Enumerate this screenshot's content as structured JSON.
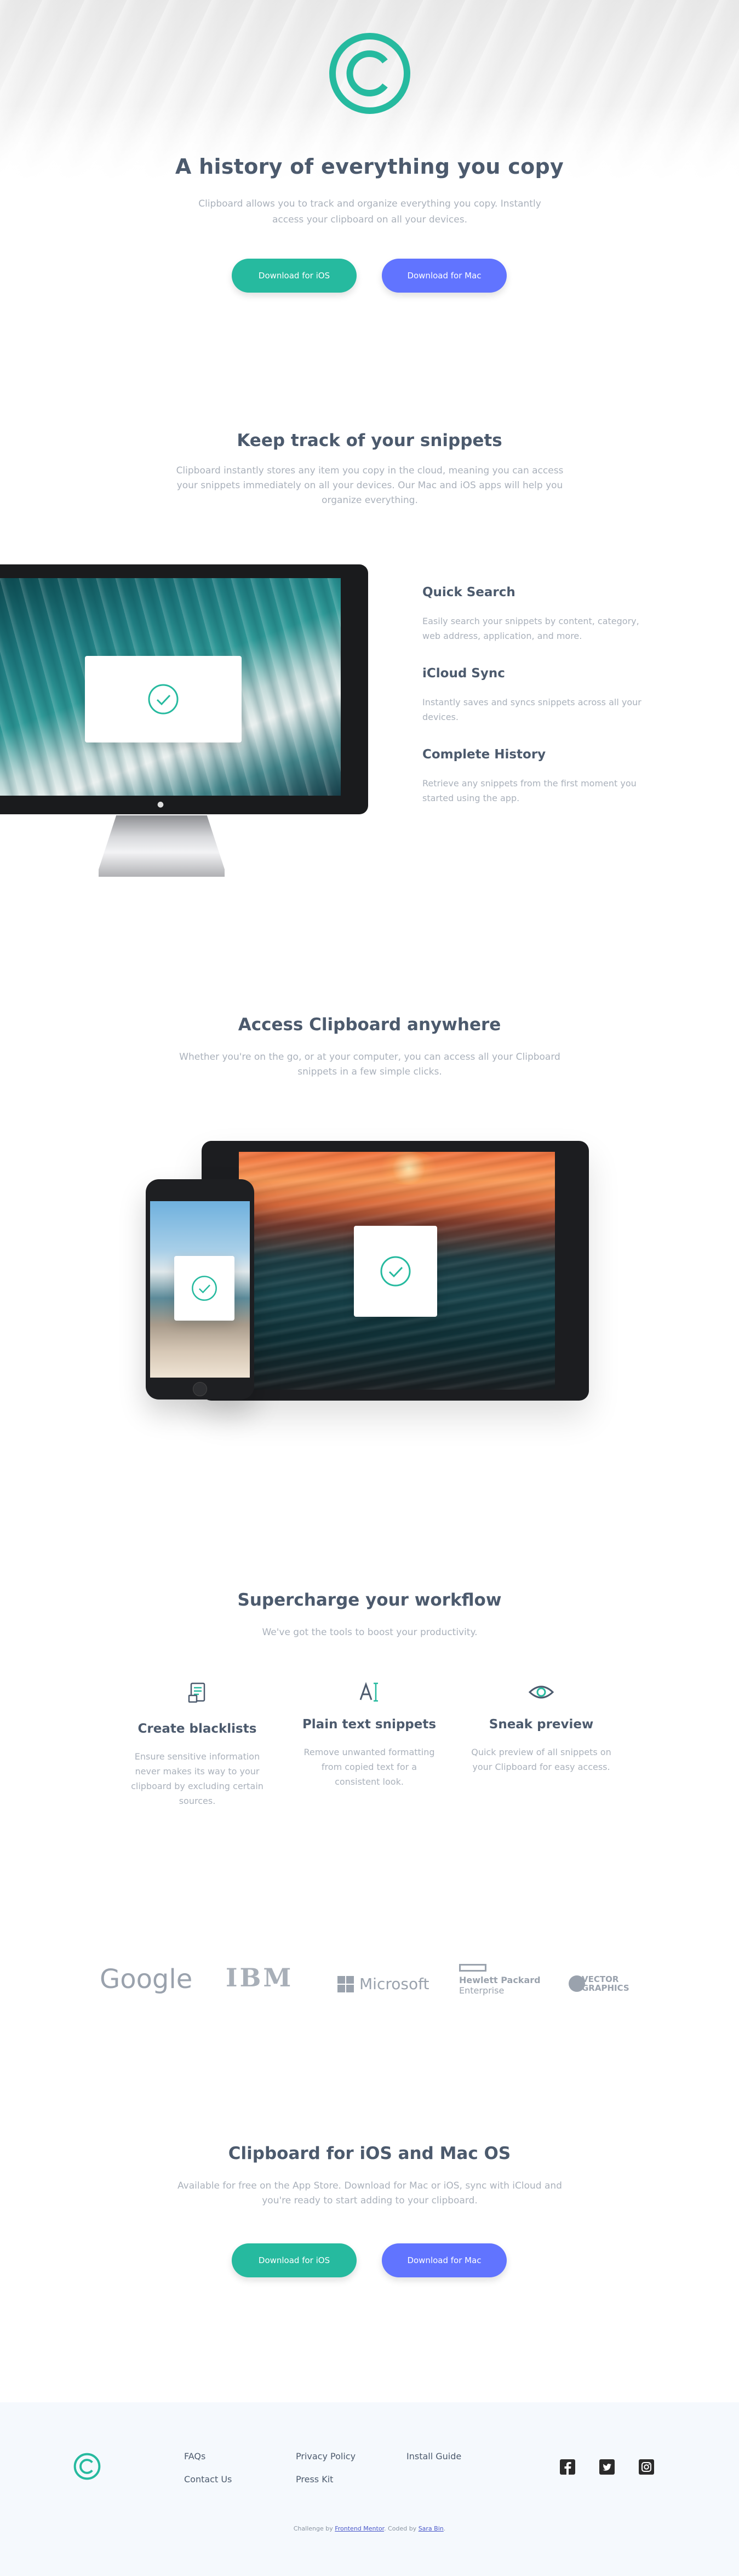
{
  "colors": {
    "teal": "#26ba9f",
    "blue": "#6174ff",
    "heading": "#4c5a6d",
    "body": "#aab1bb",
    "footer_bg": "#f5f9fd"
  },
  "hero": {
    "title": "A history of everything you copy",
    "text": "Clipboard allows you to track and organize everything you copy. Instantly access your clipboard on all your devices.",
    "ios_button": "Download for iOS",
    "mac_button": "Download for Mac"
  },
  "snippets": {
    "title": "Keep track of your snippets",
    "text": "Clipboard instantly stores any item you copy in the cloud, meaning you can access your snippets immediately on all your devices. Our Mac and iOS apps will help you organize everything.",
    "features": [
      {
        "title": "Quick Search",
        "text": "Easily search your snippets by content, category, web address, application, and more."
      },
      {
        "title": "iCloud Sync",
        "text": "Instantly saves and syncs snippets across all your devices."
      },
      {
        "title": "Complete History",
        "text": "Retrieve any snippets from the first moment you started using the app."
      }
    ]
  },
  "access": {
    "title": "Access Clipboard anywhere",
    "text": "Whether you're on the go, or at your computer, you can access all your Clipboard snippets in a few simple clicks."
  },
  "workflow": {
    "title": "Supercharge your workflow",
    "text": "We've got the tools to boost your productivity.",
    "items": [
      {
        "icon": "blacklist-icon",
        "title": "Create blacklists",
        "text": "Ensure sensitive information never makes its way to your clipboard by excluding certain sources."
      },
      {
        "icon": "text-icon",
        "title": "Plain text snippets",
        "text": "Remove unwanted formatting from copied text for a consistent look."
      },
      {
        "icon": "eye-icon",
        "title": "Sneak preview",
        "text": "Quick preview of all snippets on your Clipboard for easy access."
      }
    ]
  },
  "brands": {
    "google": "Google",
    "ibm": "IBM",
    "microsoft": "Microsoft",
    "hp_line1": "Hewlett Packard",
    "hp_line2": "Enterprise",
    "vg_line1": "VECTOR",
    "vg_line2": "GRAPHICS"
  },
  "cta": {
    "title": "Clipboard for iOS and Mac OS",
    "text": "Available for free on the App Store. Download for Mac or iOS, sync with iCloud and you're ready to start adding to your clipboard.",
    "ios_button": "Download for iOS",
    "mac_button": "Download for Mac"
  },
  "footer": {
    "links": [
      "FAQs",
      "Contact Us",
      "Privacy Policy",
      "Press Kit",
      "Install Guide"
    ],
    "social": [
      "facebook-icon",
      "twitter-icon",
      "instagram-icon"
    ],
    "attribution_prefix": "Challenge by",
    "attribution_fm": "Frontend Mentor",
    "attribution_mid": ". Coded by",
    "attribution_author": "Sara Bin",
    "attribution_end": "."
  }
}
